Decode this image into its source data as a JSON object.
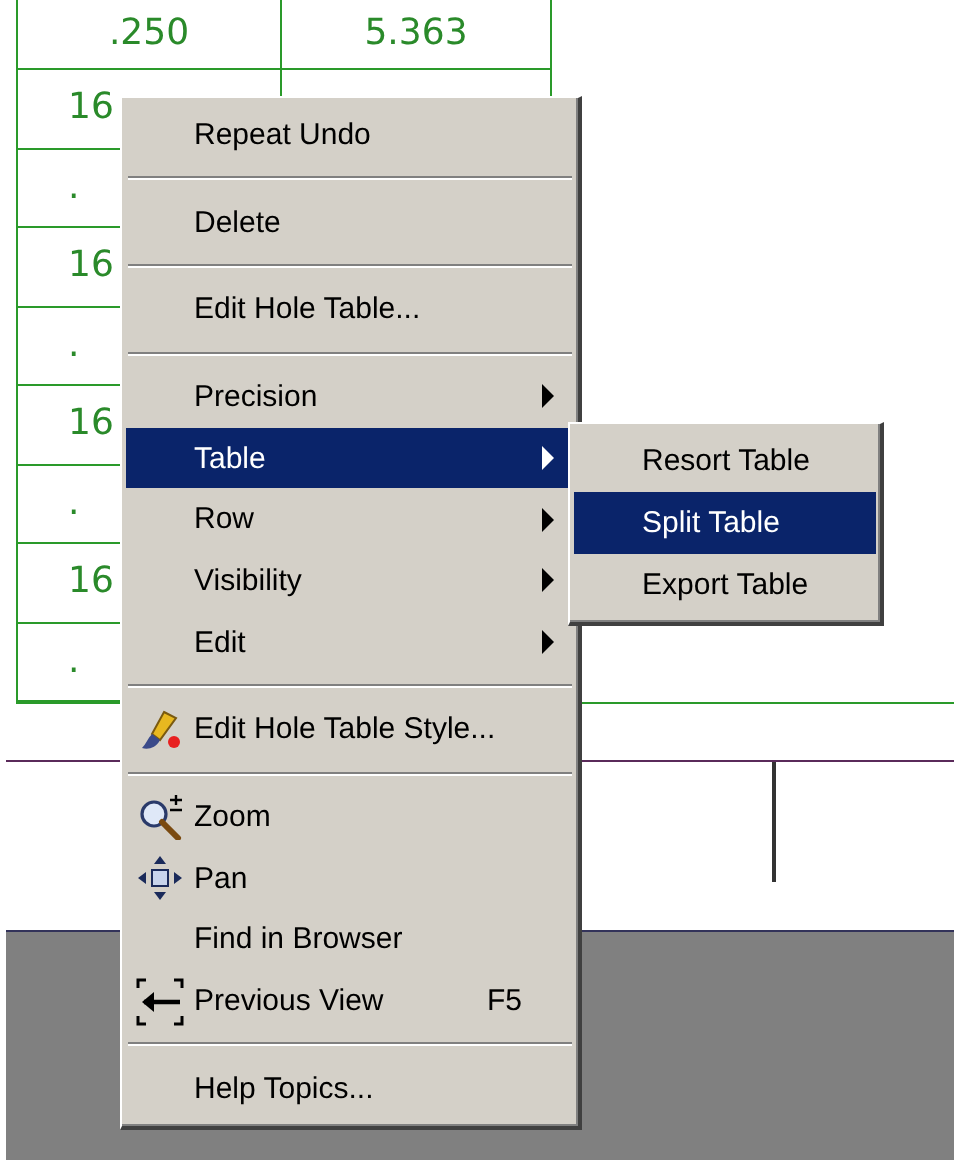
{
  "drawing": {
    "table": {
      "rows": [
        {
          "cells": [
            ".250",
            "5.363"
          ]
        },
        {
          "cells": [
            "16"
          ]
        },
        {
          "cells": [
            "."
          ]
        },
        {
          "cells": [
            "16"
          ]
        },
        {
          "cells": [
            "."
          ]
        },
        {
          "cells": [
            "16"
          ]
        },
        {
          "cells": [
            "."
          ]
        },
        {
          "cells": [
            "16"
          ]
        },
        {
          "cells": [
            "."
          ]
        }
      ]
    }
  },
  "context_menu": {
    "items": [
      {
        "kind": "command",
        "label": "Repeat Undo",
        "selected": false
      },
      {
        "kind": "separator"
      },
      {
        "kind": "command",
        "label": "Delete",
        "selected": false
      },
      {
        "kind": "separator"
      },
      {
        "kind": "command",
        "label": "Edit Hole Table...",
        "selected": false
      },
      {
        "kind": "separator"
      },
      {
        "kind": "submenu",
        "label": "Precision",
        "selected": false
      },
      {
        "kind": "submenu",
        "label": "Table",
        "selected": true
      },
      {
        "kind": "submenu",
        "label": "Row",
        "selected": false
      },
      {
        "kind": "submenu",
        "label": "Visibility",
        "selected": false
      },
      {
        "kind": "submenu",
        "label": "Edit",
        "selected": false
      },
      {
        "kind": "separator"
      },
      {
        "kind": "command",
        "label": "Edit Hole Table Style...",
        "selected": false
      },
      {
        "kind": "separator"
      },
      {
        "kind": "command",
        "label": "Zoom",
        "selected": false
      },
      {
        "kind": "command",
        "label": "Pan",
        "selected": false
      },
      {
        "kind": "command",
        "label": "Find in Browser",
        "selected": false
      },
      {
        "kind": "command",
        "label": "Previous View",
        "shortcut": "F5",
        "selected": false
      },
      {
        "kind": "separator"
      },
      {
        "kind": "command",
        "label": "Help Topics...",
        "selected": false
      }
    ]
  },
  "submenu": {
    "items": [
      {
        "label": "Resort Table",
        "selected": false
      },
      {
        "label": "Split Table",
        "selected": true
      },
      {
        "label": "Export Table",
        "selected": false
      }
    ]
  }
}
